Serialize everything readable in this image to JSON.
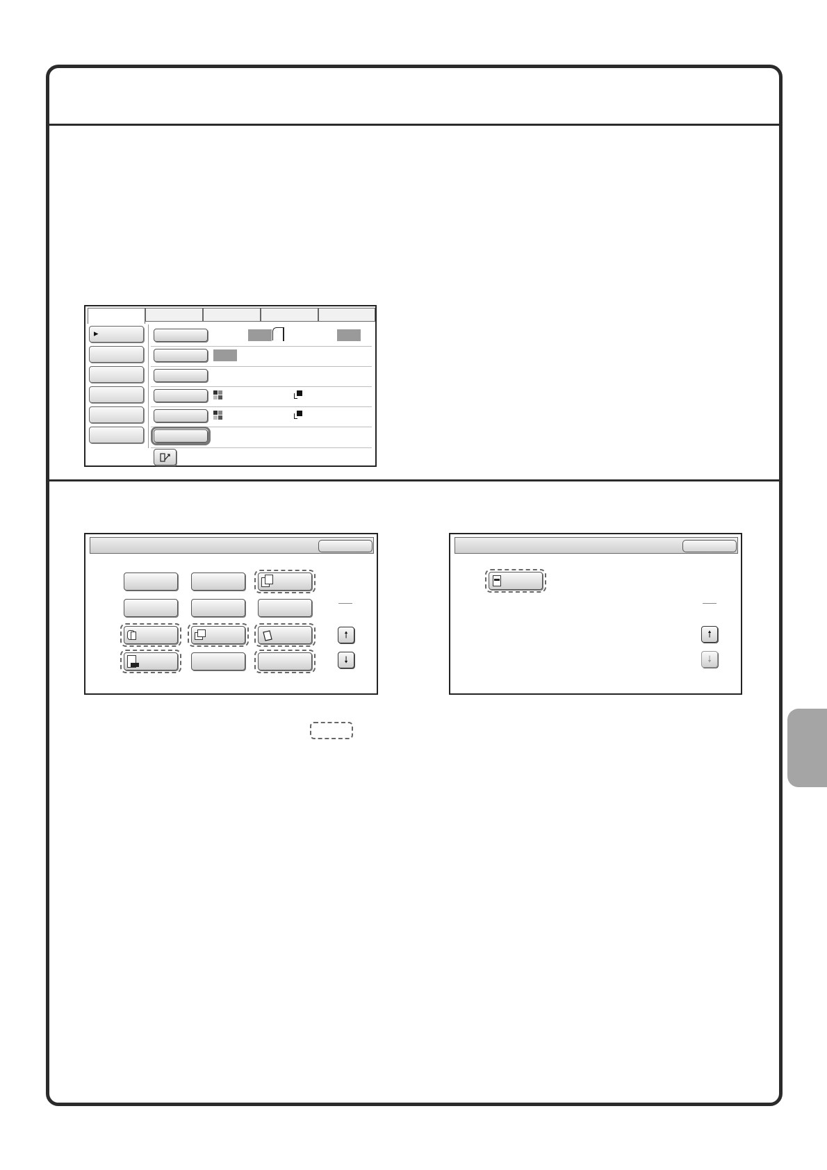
{
  "icons": {
    "play_indicator": "triangle-right-icon",
    "paper_orientation": "paper-corner-icon",
    "color_mode_full": "color-squares-icon",
    "color_mode_mono": "mono-square-icon",
    "custom_settings": "settings-wrench-icon",
    "scroll_up": "arrow-up-icon",
    "scroll_down": "arrow-down-icon"
  },
  "glyphs": {
    "play": "▸",
    "arrow_up": "🠕",
    "arrow_down": "🠗"
  },
  "colors": {
    "frame": "#2b2b2b",
    "side_tab": "#a5a5a5",
    "highlight_dash": "#666666"
  }
}
